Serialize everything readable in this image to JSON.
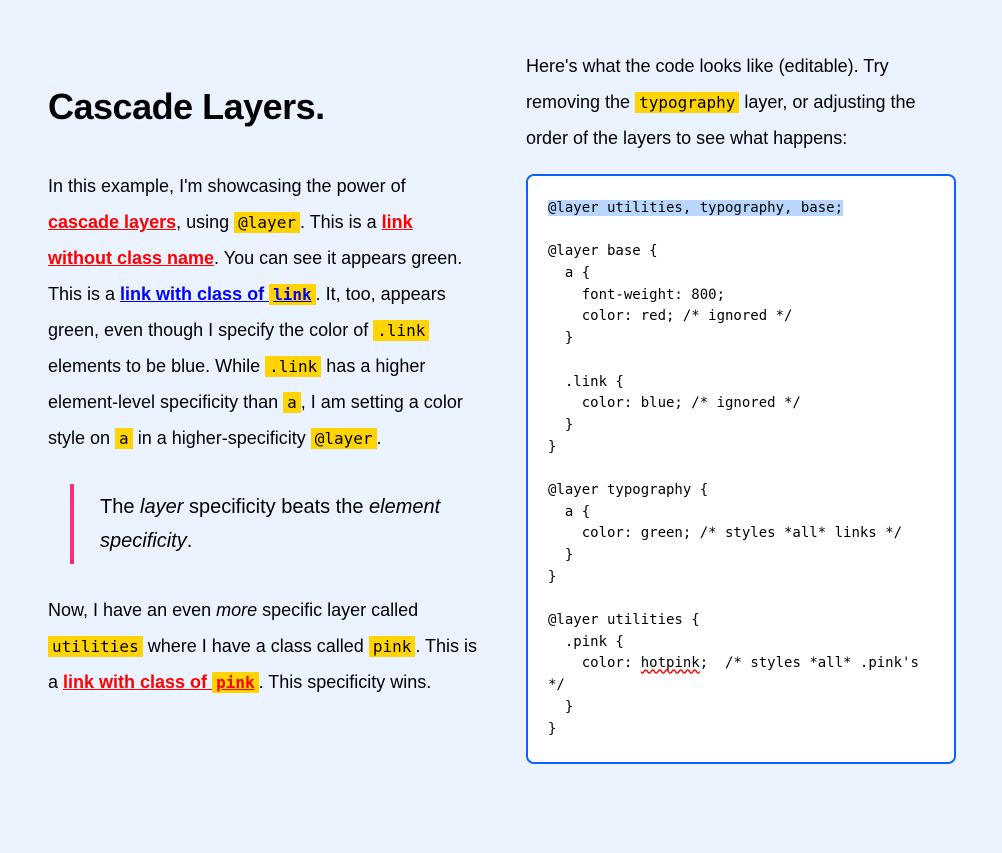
{
  "title": "Cascade Layers.",
  "p1": {
    "t1": "In this example, I'm showcasing the power of ",
    "link_cascade": "cascade layers",
    "t2": ", using ",
    "chip_layer": "@layer",
    "t3": ". This is a ",
    "link_noclass": "link without class name",
    "t4": ". You can see it appears green. This is a ",
    "link_withlink_text": "link with class of ",
    "link_withlink_chip": "link",
    "t5": ". It, too, appears green, even though I specify the color of ",
    "chip_dotlink1": ".link",
    "t6": " elements to be blue. While ",
    "chip_dotlink2": ".link",
    "t7": " has a higher element-level specificity than ",
    "chip_a1": "a",
    "t8": ", I am setting a color style on ",
    "chip_a2": "a",
    "t9": " in a higher-specificity ",
    "chip_layer2": "@layer",
    "t10": "."
  },
  "quote": {
    "t1": "The ",
    "em1": "layer",
    "t2": " specificity beats the ",
    "em2": "element specificity",
    "t3": "."
  },
  "p2": {
    "t1": "Now, I have an even ",
    "em_more": "more",
    "t2": " specific layer called ",
    "chip_util": "utilities",
    "t3": " where I have a class called ",
    "chip_pink": "pink",
    "t4": ". This is a ",
    "link_pink_text": "link with class of ",
    "link_pink_chip": "pink",
    "t5": ". This specificity wins."
  },
  "right_intro": {
    "t1": "Here's what the code looks like (editable). Try removing the ",
    "chip_typo": "typography",
    "t2": " layer, or adjusting the order of the layers to see what happens:"
  },
  "code": {
    "selected": "@layer utilities, typography, base;",
    "block1": "@layer base {\n  a {\n    font-weight: 800;\n    color: red; /* ignored */\n  }\n\n  .link {\n    color: blue; /* ignored */\n  }\n}",
    "block2": "@layer typography {\n  a {\n    color: green; /* styles *all* links */\n  }\n}",
    "block3_pre": "@layer utilities {\n  .pink {\n    color: ",
    "block3_spell": "hotpink",
    "block3_post": ";  /* styles *all* .pink's */\n  }\n}"
  }
}
